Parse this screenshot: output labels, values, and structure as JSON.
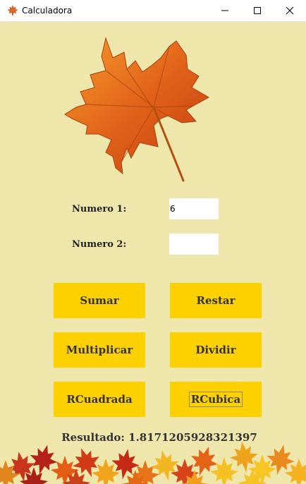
{
  "window": {
    "title": "Calculadora",
    "icon": "maple-leaf-icon"
  },
  "form": {
    "numero1_label": "Numero 1:",
    "numero1_value": "6",
    "numero2_label": "Numero 2:",
    "numero2_value": ""
  },
  "buttons": {
    "sumar": "Sumar",
    "restar": "Restar",
    "multiplicar": "Multiplicar",
    "dividir": "Dividir",
    "rcuadrada": "RCuadrada",
    "rcubica": "RCubica"
  },
  "result": {
    "text": "Resultado: 1.8171205928321397"
  },
  "colors": {
    "background": "#efe6ac",
    "button": "#fdd000",
    "button_text": "#333333",
    "leaf": "#e06a10"
  }
}
